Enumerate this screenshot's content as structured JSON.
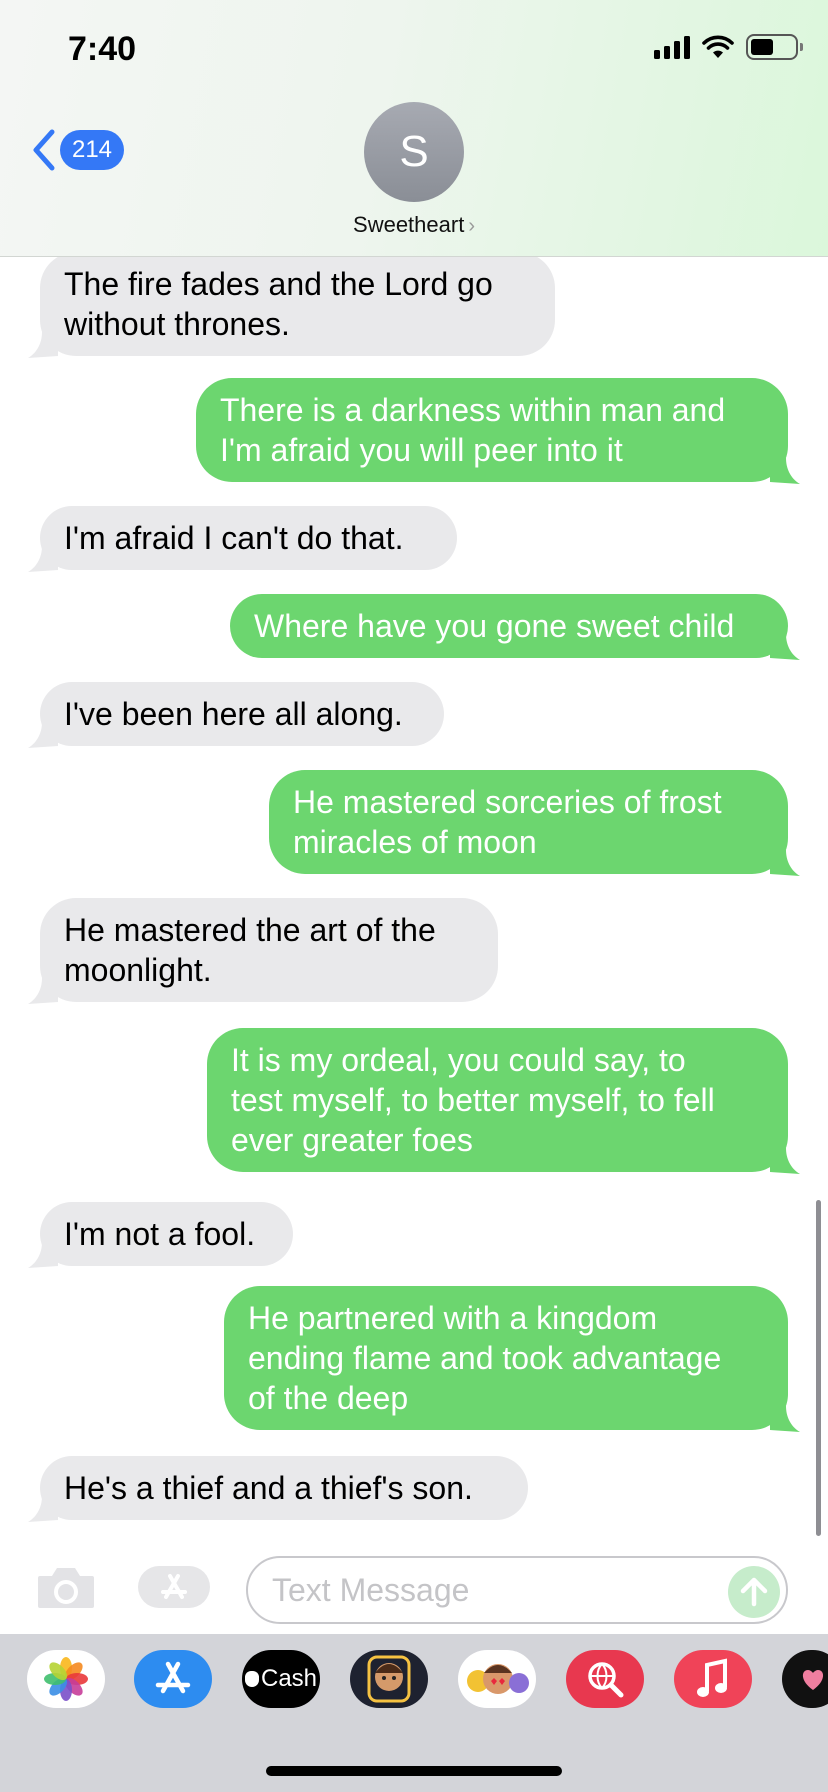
{
  "status_bar": {
    "time": "7:40"
  },
  "header": {
    "back_badge": "214",
    "avatar_initial": "S",
    "contact_name": "Sweetheart",
    "contact_chevron": "›"
  },
  "messages": [
    {
      "dir": "in",
      "text": "The fire fades and the Lord go\nwithout thrones."
    },
    {
      "dir": "out",
      "text": "There is a darkness within man and\nI'm afraid you will peer into it"
    },
    {
      "dir": "in",
      "text": "I'm afraid I can't do that."
    },
    {
      "dir": "out",
      "text": "Where have you gone sweet child"
    },
    {
      "dir": "in",
      "text": "I've been here all along."
    },
    {
      "dir": "out",
      "text": "He mastered sorceries of frost\nmiracles of moon"
    },
    {
      "dir": "in",
      "text": "He mastered the art of the\nmoonlight."
    },
    {
      "dir": "out",
      "text": "It is my ordeal, you could say, to\ntest myself, to better myself, to fell\never greater foes"
    },
    {
      "dir": "in",
      "text": "I'm not a fool."
    },
    {
      "dir": "out",
      "text": "He partnered with a kingdom\nending flame and took advantage\nof the deep"
    },
    {
      "dir": "in",
      "text": "He's a thief and a thief's son."
    }
  ],
  "composer": {
    "placeholder": "Text Message",
    "value": ""
  },
  "drawer": {
    "apps": [
      {
        "name": "photos-app-icon"
      },
      {
        "name": "app-store-app-icon"
      },
      {
        "name": "apple-cash-app-icon",
        "label": "Cash"
      },
      {
        "name": "memoji-camera-app-icon"
      },
      {
        "name": "memoji-stickers-app-icon"
      },
      {
        "name": "web-images-search-app-icon"
      },
      {
        "name": "music-app-icon"
      },
      {
        "name": "digital-touch-app-icon"
      }
    ]
  },
  "colors": {
    "outgoing": "#6cd66f",
    "incoming": "#e9e9eb",
    "accent": "#3478f6"
  }
}
